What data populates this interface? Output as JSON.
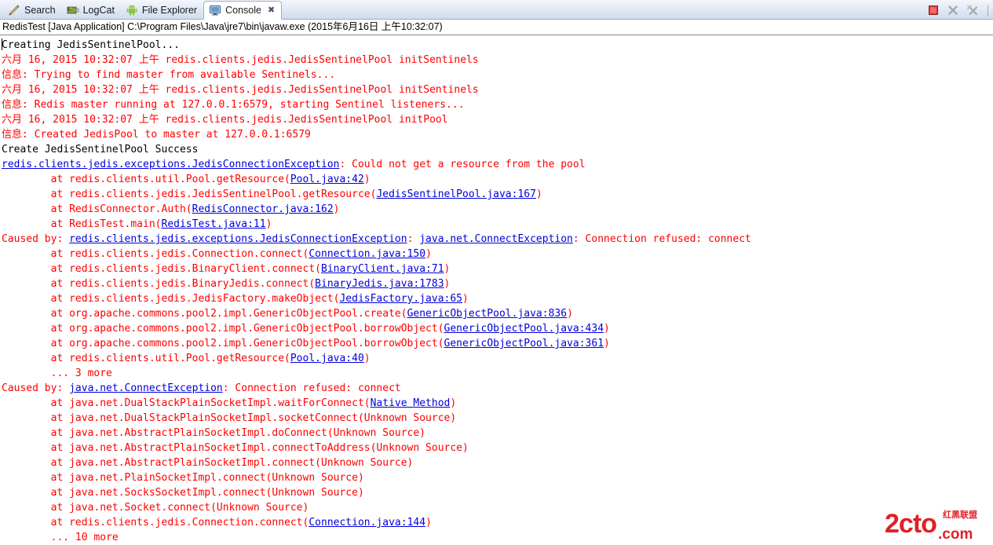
{
  "window": {
    "tabs": [
      {
        "label": "Search",
        "icon": "search-pencil-icon",
        "active": false
      },
      {
        "label": "LogCat",
        "icon": "logcat-icon",
        "active": false
      },
      {
        "label": "File Explorer",
        "icon": "android-icon",
        "active": false
      },
      {
        "label": "Console",
        "icon": "console-monitor-icon",
        "active": true
      }
    ],
    "tab_close_glyph": "✖",
    "toolbar": {
      "stop_label": "Terminate",
      "remove_label": "Remove Launch",
      "remove_all_label": "Remove All Terminated Launches"
    }
  },
  "process_header": {
    "text": "RedisTest [Java Application] C:\\Program Files\\Java\\jre7\\bin\\javaw.exe (2015年6月16日 上午10:32:07)"
  },
  "console": {
    "lines": [
      {
        "color": "black",
        "parts": [
          {
            "t": "Creating JedisSentinelPool..."
          }
        ]
      },
      {
        "color": "red",
        "parts": [
          {
            "t": "六月 16, 2015 10:32:07 上午 redis.clients.jedis.JedisSentinelPool initSentinels"
          }
        ]
      },
      {
        "color": "red",
        "parts": [
          {
            "t": "信息: Trying to find master from available Sentinels..."
          }
        ]
      },
      {
        "color": "red",
        "parts": [
          {
            "t": "六月 16, 2015 10:32:07 上午 redis.clients.jedis.JedisSentinelPool initSentinels"
          }
        ]
      },
      {
        "color": "red",
        "parts": [
          {
            "t": "信息: Redis master running at 127.0.0.1:6579, starting Sentinel listeners..."
          }
        ]
      },
      {
        "color": "red",
        "parts": [
          {
            "t": "六月 16, 2015 10:32:07 上午 redis.clients.jedis.JedisSentinelPool initPool"
          }
        ]
      },
      {
        "color": "red",
        "parts": [
          {
            "t": "信息: Created JedisPool to master at 127.0.0.1:6579"
          }
        ]
      },
      {
        "color": "black",
        "parts": [
          {
            "t": "Create JedisSentinelPool Success"
          }
        ]
      },
      {
        "color": "red",
        "parts": [
          {
            "t": "redis.clients.jedis.exceptions.JedisConnectionException",
            "link": true
          },
          {
            "t": ": Could not get a resource from the pool"
          }
        ]
      },
      {
        "color": "red",
        "parts": [
          {
            "t": "\tat redis.clients.util.Pool.getResource("
          },
          {
            "t": "Pool.java:42",
            "link": true
          },
          {
            "t": ")"
          }
        ]
      },
      {
        "color": "red",
        "parts": [
          {
            "t": "\tat redis.clients.jedis.JedisSentinelPool.getResource("
          },
          {
            "t": "JedisSentinelPool.java:167",
            "link": true
          },
          {
            "t": ")"
          }
        ]
      },
      {
        "color": "red",
        "parts": [
          {
            "t": "\tat RedisConnector.Auth("
          },
          {
            "t": "RedisConnector.java:162",
            "link": true
          },
          {
            "t": ")"
          }
        ]
      },
      {
        "color": "red",
        "parts": [
          {
            "t": "\tat RedisTest.main("
          },
          {
            "t": "RedisTest.java:11",
            "link": true
          },
          {
            "t": ")"
          }
        ]
      },
      {
        "color": "red",
        "parts": [
          {
            "t": "Caused by: "
          },
          {
            "t": "redis.clients.jedis.exceptions.JedisConnectionException",
            "link": true
          },
          {
            "t": ": "
          },
          {
            "t": "java.net.ConnectException",
            "link": true
          },
          {
            "t": ": Connection refused: connect"
          }
        ]
      },
      {
        "color": "red",
        "parts": [
          {
            "t": "\tat redis.clients.jedis.Connection.connect("
          },
          {
            "t": "Connection.java:150",
            "link": true
          },
          {
            "t": ")"
          }
        ]
      },
      {
        "color": "red",
        "parts": [
          {
            "t": "\tat redis.clients.jedis.BinaryClient.connect("
          },
          {
            "t": "BinaryClient.java:71",
            "link": true
          },
          {
            "t": ")"
          }
        ]
      },
      {
        "color": "red",
        "parts": [
          {
            "t": "\tat redis.clients.jedis.BinaryJedis.connect("
          },
          {
            "t": "BinaryJedis.java:1783",
            "link": true
          },
          {
            "t": ")"
          }
        ]
      },
      {
        "color": "red",
        "parts": [
          {
            "t": "\tat redis.clients.jedis.JedisFactory.makeObject("
          },
          {
            "t": "JedisFactory.java:65",
            "link": true
          },
          {
            "t": ")"
          }
        ]
      },
      {
        "color": "red",
        "parts": [
          {
            "t": "\tat org.apache.commons.pool2.impl.GenericObjectPool.create("
          },
          {
            "t": "GenericObjectPool.java:836",
            "link": true
          },
          {
            "t": ")"
          }
        ]
      },
      {
        "color": "red",
        "parts": [
          {
            "t": "\tat org.apache.commons.pool2.impl.GenericObjectPool.borrowObject("
          },
          {
            "t": "GenericObjectPool.java:434",
            "link": true
          },
          {
            "t": ")"
          }
        ]
      },
      {
        "color": "red",
        "parts": [
          {
            "t": "\tat org.apache.commons.pool2.impl.GenericObjectPool.borrowObject("
          },
          {
            "t": "GenericObjectPool.java:361",
            "link": true
          },
          {
            "t": ")"
          }
        ]
      },
      {
        "color": "red",
        "parts": [
          {
            "t": "\tat redis.clients.util.Pool.getResource("
          },
          {
            "t": "Pool.java:40",
            "link": true
          },
          {
            "t": ")"
          }
        ]
      },
      {
        "color": "red",
        "parts": [
          {
            "t": "\t... 3 more"
          }
        ]
      },
      {
        "color": "red",
        "parts": [
          {
            "t": "Caused by: "
          },
          {
            "t": "java.net.ConnectException",
            "link": true
          },
          {
            "t": ": Connection refused: connect"
          }
        ]
      },
      {
        "color": "red",
        "parts": [
          {
            "t": "\tat java.net.DualStackPlainSocketImpl.waitForConnect("
          },
          {
            "t": "Native Method",
            "link": true
          },
          {
            "t": ")"
          }
        ]
      },
      {
        "color": "red",
        "parts": [
          {
            "t": "\tat java.net.DualStackPlainSocketImpl.socketConnect(Unknown Source)"
          }
        ]
      },
      {
        "color": "red",
        "parts": [
          {
            "t": "\tat java.net.AbstractPlainSocketImpl.doConnect(Unknown Source)"
          }
        ]
      },
      {
        "color": "red",
        "parts": [
          {
            "t": "\tat java.net.AbstractPlainSocketImpl.connectToAddress(Unknown Source)"
          }
        ]
      },
      {
        "color": "red",
        "parts": [
          {
            "t": "\tat java.net.AbstractPlainSocketImpl.connect(Unknown Source)"
          }
        ]
      },
      {
        "color": "red",
        "parts": [
          {
            "t": "\tat java.net.PlainSocketImpl.connect(Unknown Source)"
          }
        ]
      },
      {
        "color": "red",
        "parts": [
          {
            "t": "\tat java.net.SocksSocketImpl.connect(Unknown Source)"
          }
        ]
      },
      {
        "color": "red",
        "parts": [
          {
            "t": "\tat java.net.Socket.connect(Unknown Source)"
          }
        ]
      },
      {
        "color": "red",
        "parts": [
          {
            "t": "\tat redis.clients.jedis.Connection.connect("
          },
          {
            "t": "Connection.java:144",
            "link": true
          },
          {
            "t": ")"
          }
        ]
      },
      {
        "color": "red",
        "parts": [
          {
            "t": "\t... 10 more"
          }
        ]
      }
    ]
  },
  "watermark": {
    "main_text": "2cto",
    "suffix_text": ".com",
    "cn_text": "红黑联盟"
  },
  "colors": {
    "error_red": "#ff0000",
    "link_blue": "#0000dd",
    "tab_active_bg": "#ffffff",
    "tabbar_bg": "#dfe8f4",
    "stop_icon_red": "#cc2222"
  }
}
